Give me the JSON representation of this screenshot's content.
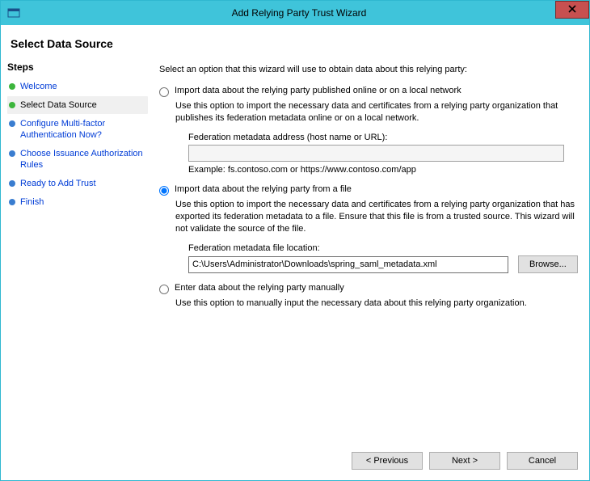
{
  "window": {
    "title": "Add Relying Party Trust Wizard",
    "close_label": "Close"
  },
  "header": {
    "title": "Select Data Source"
  },
  "sidebar": {
    "title": "Steps",
    "items": [
      {
        "label": "Welcome",
        "status": "done",
        "selected": false
      },
      {
        "label": "Select Data Source",
        "status": "done",
        "selected": true
      },
      {
        "label": "Configure Multi-factor Authentication Now?",
        "status": "pending",
        "selected": false
      },
      {
        "label": "Choose Issuance Authorization Rules",
        "status": "pending",
        "selected": false
      },
      {
        "label": "Ready to Add Trust",
        "status": "pending",
        "selected": false
      },
      {
        "label": "Finish",
        "status": "pending",
        "selected": false
      }
    ]
  },
  "main": {
    "intro": "Select an option that this wizard will use to obtain data about this relying party:",
    "options": {
      "online": {
        "label": "Import data about the relying party published online or on a local network",
        "desc": "Use this option to import the necessary data and certificates from a relying party organization that publishes its federation metadata online or on a local network.",
        "field_label": "Federation metadata address (host name or URL):",
        "field_value": "",
        "example": "Example: fs.contoso.com or https://www.contoso.com/app"
      },
      "file": {
        "label": "Import data about the relying party from a file",
        "desc": "Use this option to import the necessary data and certificates from a relying party organization that has exported its federation metadata to a file. Ensure that this file is from a trusted source.  This wizard will not validate the source of the file.",
        "field_label": "Federation metadata file location:",
        "field_value": "C:\\Users\\Administrator\\Downloads\\spring_saml_metadata.xml",
        "browse_label": "Browse..."
      },
      "manual": {
        "label": "Enter data about the relying party manually",
        "desc": "Use this option to manually input the necessary data about this relying party organization."
      },
      "selected": "file"
    }
  },
  "footer": {
    "previous": "< Previous",
    "next": "Next >",
    "cancel": "Cancel"
  }
}
